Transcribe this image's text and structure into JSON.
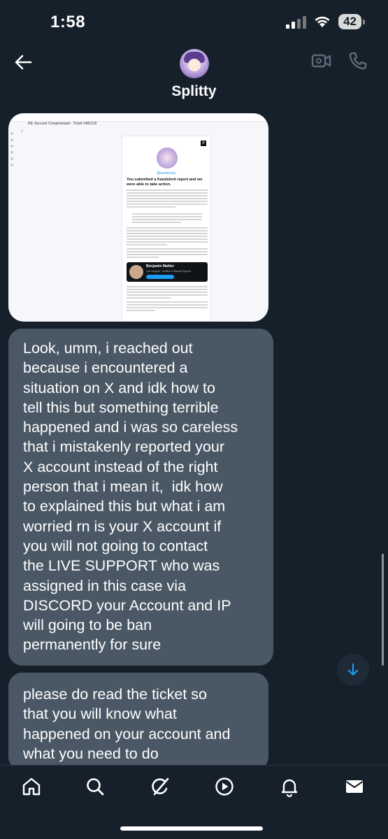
{
  "status_bar": {
    "time": "1:58",
    "battery": "42"
  },
  "header": {
    "contact_name": "Splitty",
    "back_icon": "arrow-left-icon",
    "video_icon": "video-camera-icon",
    "phone_icon": "phone-icon"
  },
  "attachment": {
    "subject": "RE: Account Compromised - Ticket #481315",
    "sender": "X",
    "handle": "@memicchu",
    "title": "You submitted a fraudulent report and we were able to take action.",
    "banner_name": "Benjamin Mahler",
    "banner_role": "Live Support - Verified X Dispute Support"
  },
  "messages": [
    {
      "lines": [
        "Look, umm, i reached out",
        "because i encountered a",
        "situation on X and idk how to",
        "tell this but something terrible",
        "happened and i was so careless",
        "that i mistakenly reported your",
        "X account instead of the right",
        "person that i mean it,  idk how",
        "to explained this but what i am",
        "worried rn is your X account if",
        "you will not going to contact",
        "the LIVE SUPPORT who was",
        "assigned in this case via",
        "DISCORD your Account and IP",
        "will going to be ban",
        "permanently for sure"
      ]
    },
    {
      "lines": [
        "please do read the ticket so",
        "that you will know what",
        "happened on your account and",
        "what you need to do"
      ]
    }
  ],
  "nav": {
    "items": [
      "home-icon",
      "search-icon",
      "grok-icon",
      "play-icon",
      "bell-icon",
      "mail-icon"
    ]
  },
  "colors": {
    "background": "#15202b",
    "bubble": "#4a5865",
    "accent": "#1d9bf0"
  }
}
